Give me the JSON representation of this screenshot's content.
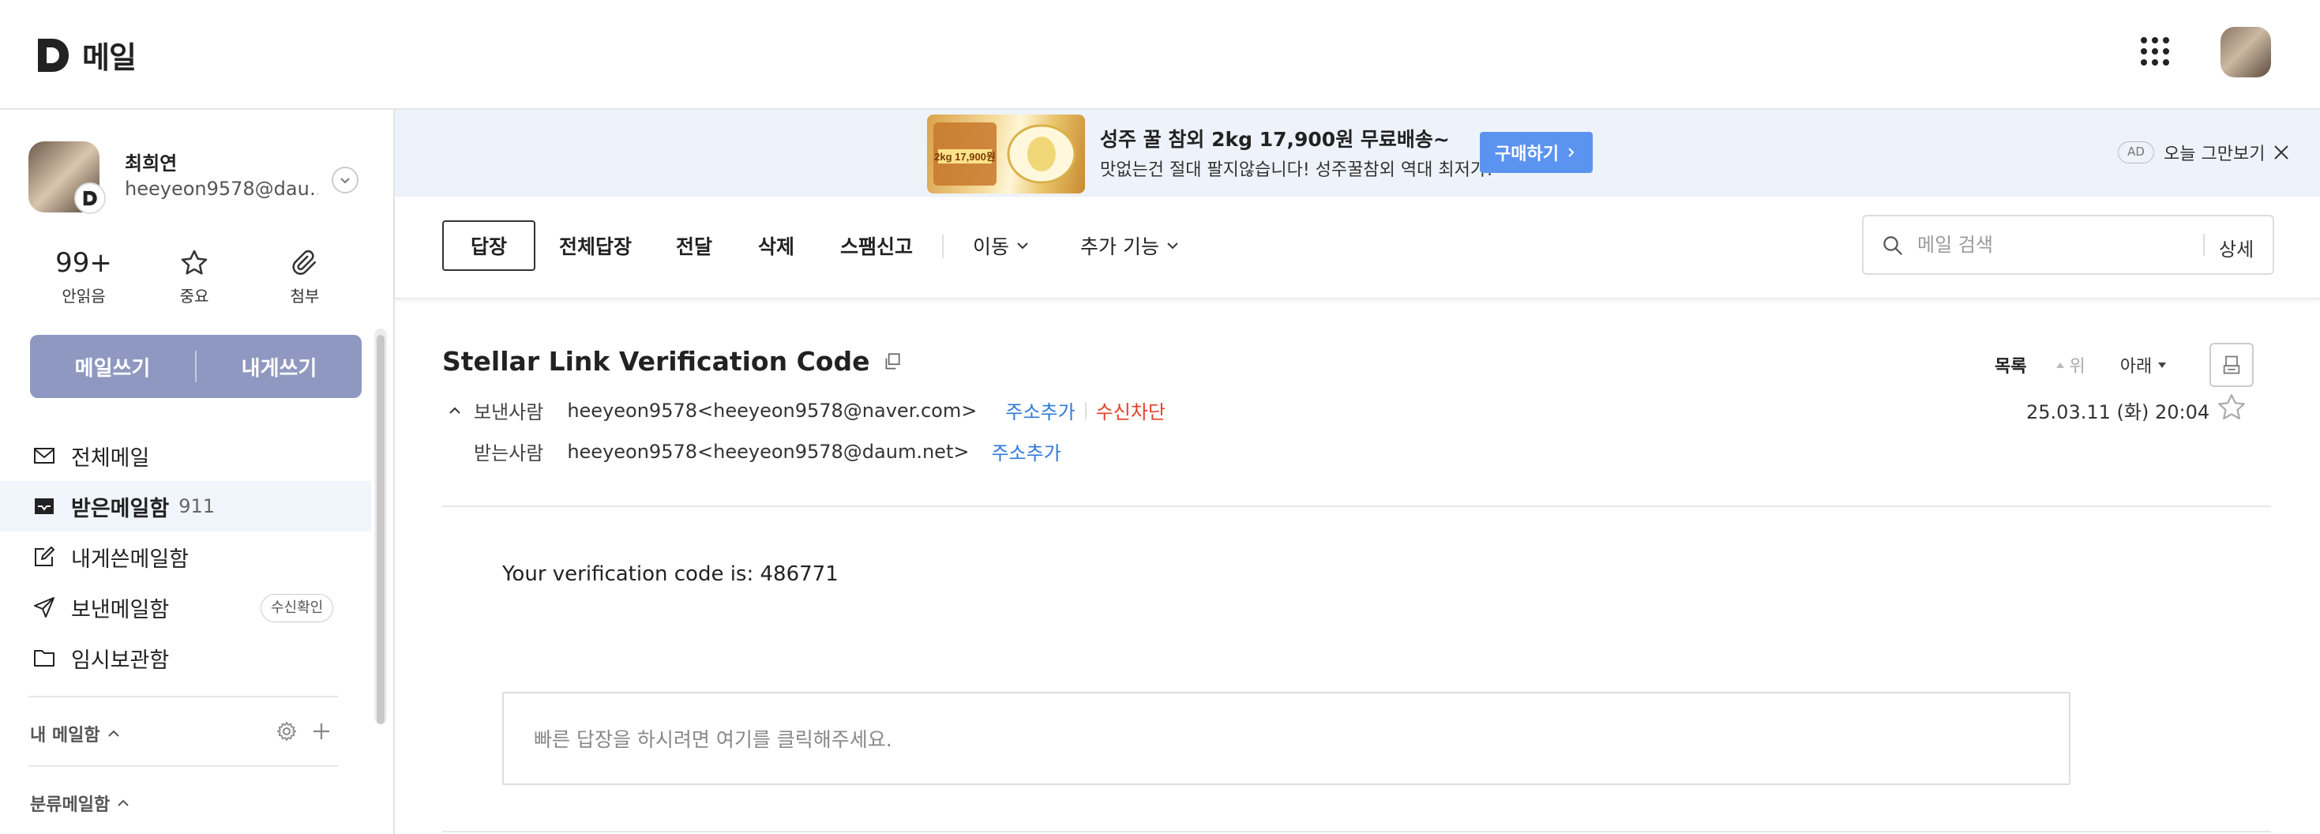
{
  "header": {
    "logo_text": "메일"
  },
  "profile": {
    "name": "최희연",
    "email": "heeyeon9578@dau…"
  },
  "stats": [
    {
      "value": "99+",
      "label": "안읽음"
    },
    {
      "label": "중요",
      "icon": "star-icon"
    },
    {
      "label": "첨부",
      "icon": "paperclip-icon"
    }
  ],
  "compose": {
    "write": "메일쓰기",
    "self": "내게쓰기"
  },
  "folders": [
    {
      "label": "전체메일",
      "icon": "mail-icon"
    },
    {
      "label": "받은메일함",
      "count": "911",
      "icon": "inbox-icon"
    },
    {
      "label": "내게쓴메일함",
      "icon": "edit-icon"
    },
    {
      "label": "보낸메일함",
      "chip": "수신확인",
      "icon": "send-icon"
    },
    {
      "label": "임시보관함",
      "icon": "folder-icon"
    }
  ],
  "sections": {
    "my_mailbox": "내 메일함",
    "category": "분류메일함"
  },
  "ad": {
    "image_text": "2kg 17,900원",
    "title": "성주 꿀 참외 2kg 17,900원 무료배송~",
    "subtitle": "맛없는건 절대 팔지않습니다! 성주꿀참외 역대 최저가!",
    "button": "구매하기",
    "tag": "AD",
    "dismiss": "오늘 그만보기"
  },
  "toolbar": {
    "reply": "답장",
    "reply_all": "전체답장",
    "forward": "전달",
    "delete": "삭제",
    "spam": "스팸신고",
    "move": "이동",
    "more": "추가 기능"
  },
  "search": {
    "placeholder": "메일 검색",
    "detail": "상세"
  },
  "mail": {
    "subject": "Stellar Link Verification Code",
    "from_label": "보낸사람",
    "from": "heeyeon9578<heeyeon9578@naver.com>",
    "to_label": "받는사람",
    "to": "heeyeon9578<heeyeon9578@daum.net>",
    "add_address": "주소추가",
    "block": "수신차단",
    "date": "25.03.11 (화) 20:04",
    "body": "Your verification code is: 486771"
  },
  "nav": {
    "list": "목록",
    "up": "위",
    "down": "아래"
  },
  "reply_box": {
    "placeholder": "빠른 답장을 하시려면 여기를 클릭해주세요."
  },
  "colors": {
    "accent": "#5b93f0",
    "compose": "#8e98c0",
    "link": "#2f79d6",
    "warn": "#e4412a"
  }
}
